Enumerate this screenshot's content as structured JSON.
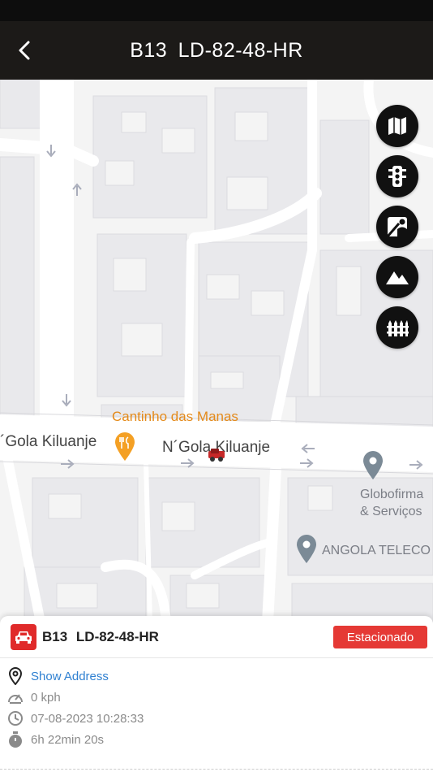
{
  "header": {
    "title": "B13  LD-82-48-HR",
    "back_icon": "chevron-left-icon"
  },
  "map": {
    "labels": {
      "poi_restaurant": "Cantinho das Manas",
      "street_left": "´Gola Kiluanje",
      "street_center": "N´Gola Kiluanje",
      "poi_globo_line1": "Globofirma",
      "poi_globo_line2": "& Serviços",
      "poi_angola": "ANGOLA TELECO"
    },
    "controls": [
      "map-type-icon",
      "traffic-icon",
      "street-view-icon",
      "terrain-icon",
      "fence-icon"
    ]
  },
  "panel": {
    "vehicle": "B13  LD-82-48-HR",
    "status": "Estacionado",
    "address_link": "Show Address",
    "speed": "0 kph",
    "datetime": "07-08-2023 10:28:33",
    "duration": "6h 22min 20s"
  },
  "colors": {
    "status_red": "#e53935",
    "link_blue": "#2f80d1",
    "header_bg": "#1c1a18",
    "poi_orange": "#e48a1a"
  }
}
